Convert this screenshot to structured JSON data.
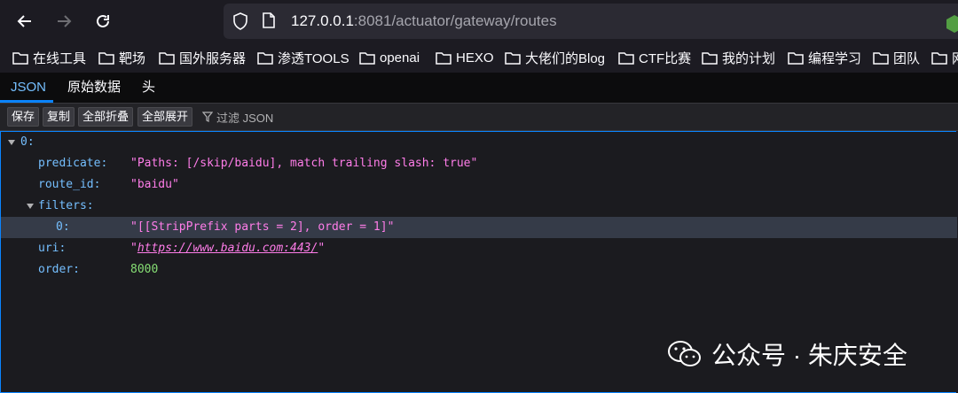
{
  "browser": {
    "url_host": "127.0.0.1",
    "url_rest": ":8081/actuator/gateway/routes"
  },
  "bookmarks": [
    "在线工具",
    "靶场",
    "国外服务器",
    "渗透TOOLS",
    "openai",
    "HEXO",
    "大佬们的Blog",
    "CTF比赛",
    "我的计划",
    "编程学习",
    "团队",
    "网"
  ],
  "viewer_tabs": [
    "JSON",
    "原始数据",
    "头"
  ],
  "toolbar_buttons": [
    "保存",
    "复制",
    "全部折叠",
    "全部展开"
  ],
  "filter_label": "过滤 JSON",
  "json": {
    "root_key": "0:",
    "predicate_key": "predicate:",
    "predicate_val": "\"Paths: [/skip/baidu], match trailing slash: true\"",
    "route_id_key": "route_id:",
    "route_id_val": "\"baidu\"",
    "filters_key": "filters:",
    "filter0_key": "0:",
    "filter0_val": "\"[[StripPrefix parts = 2], order = 1]\"",
    "uri_key": "uri:",
    "uri_quote_open": "\"",
    "uri_val": "https://www.baidu.com:443/",
    "uri_quote_close": "\"",
    "order_key": "order:",
    "order_val": "8000"
  },
  "watermark": "公众号 · 朱庆安全"
}
